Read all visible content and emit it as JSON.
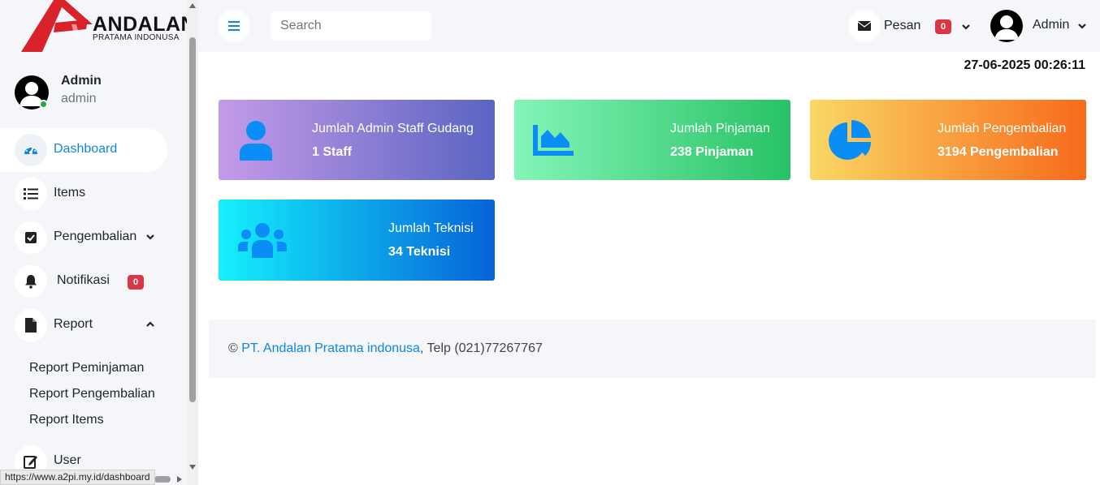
{
  "brand": {
    "name": "ANDALAN",
    "tagline": "PRATAMA INDONUSA"
  },
  "user": {
    "name": "Admin",
    "role": "admin"
  },
  "sidebar": {
    "items": [
      {
        "label": "Dashboard",
        "icon": "gauge-icon"
      },
      {
        "label": "Items",
        "icon": "list-icon"
      },
      {
        "label": "Pengembalian",
        "icon": "check-square-icon"
      },
      {
        "label": "Notifikasi",
        "icon": "bell-icon",
        "badge": "0"
      },
      {
        "label": "Report",
        "icon": "file-icon"
      },
      {
        "label": "User",
        "icon": "edit-icon"
      }
    ],
    "report_submenu": [
      "Report Peminjaman",
      "Report Pengembalian",
      "Report Items"
    ]
  },
  "topbar": {
    "search_placeholder": "Search",
    "messages_label": "Pesan",
    "messages_badge": "0",
    "admin_label": "Admin"
  },
  "datetime": "27-06-2025 00:26:11",
  "cards": [
    {
      "title": "Jumlah Admin Staff Gudang",
      "value": "1 Staff",
      "icon": "user-icon",
      "gradient": [
        "#c49be8",
        "#5a64c2"
      ]
    },
    {
      "title": "Jumlah Pinjaman",
      "value": "238 Pinjaman",
      "icon": "area-chart-icon",
      "gradient": [
        "#84f5b8",
        "#28c265"
      ]
    },
    {
      "title": "Jumlah Pengembalian",
      "value": "3194 Pengembalian",
      "icon": "pie-chart-icon",
      "gradient": [
        "#fad765",
        "#f76a1c"
      ]
    },
    {
      "title": "Jumlah Teknisi",
      "value": "34 Teknisi",
      "icon": "users-icon",
      "gradient": [
        "#15f0fc",
        "#0662d8"
      ]
    }
  ],
  "footer": {
    "copyright": "©",
    "company": "PT. Andalan Pratama indonusa",
    "phone": ", Telp (021)77267767"
  },
  "status_url": "https://www.a2pi.my.id/dashboard"
}
